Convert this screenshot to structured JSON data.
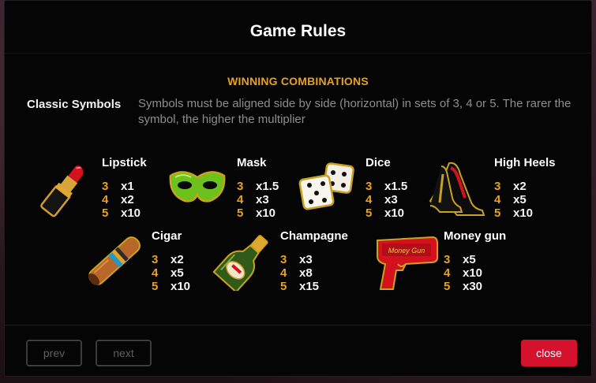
{
  "modal": {
    "title": "Game Rules",
    "section_title": "WINNING COMBINATIONS",
    "classic_label": "Classic Symbols",
    "classic_description": "Symbols must be aligned side by side (horizontal) in sets of 3, 4 or 5. The rarer the symbol, the higher the multiplier"
  },
  "symbols": [
    {
      "name": "Lipstick",
      "icon": "lipstick-icon",
      "payouts": [
        {
          "count": "3",
          "mult": "x1"
        },
        {
          "count": "4",
          "mult": "x2"
        },
        {
          "count": "5",
          "mult": "x10"
        }
      ]
    },
    {
      "name": "Mask",
      "icon": "mask-icon",
      "payouts": [
        {
          "count": "3",
          "mult": "x1.5"
        },
        {
          "count": "4",
          "mult": "x3"
        },
        {
          "count": "5",
          "mult": "x10"
        }
      ]
    },
    {
      "name": "Dice",
      "icon": "dice-icon",
      "payouts": [
        {
          "count": "3",
          "mult": "x1.5"
        },
        {
          "count": "4",
          "mult": "x3"
        },
        {
          "count": "5",
          "mult": "x10"
        }
      ]
    },
    {
      "name": "High Heels",
      "icon": "high-heels-icon",
      "payouts": [
        {
          "count": "3",
          "mult": "x2"
        },
        {
          "count": "4",
          "mult": "x5"
        },
        {
          "count": "5",
          "mult": "x10"
        }
      ]
    },
    {
      "name": "Cigar",
      "icon": "cigar-icon",
      "payouts": [
        {
          "count": "3",
          "mult": "x2"
        },
        {
          "count": "4",
          "mult": "x5"
        },
        {
          "count": "5",
          "mult": "x10"
        }
      ]
    },
    {
      "name": "Champagne",
      "icon": "champagne-icon",
      "payouts": [
        {
          "count": "3",
          "mult": "x3"
        },
        {
          "count": "4",
          "mult": "x8"
        },
        {
          "count": "5",
          "mult": "x15"
        }
      ]
    },
    {
      "name": "Money gun",
      "icon": "money-gun-icon",
      "icon_text": "Money Gun",
      "payouts": [
        {
          "count": "3",
          "mult": "x5"
        },
        {
          "count": "4",
          "mult": "x10"
        },
        {
          "count": "5",
          "mult": "x30"
        }
      ]
    }
  ],
  "footer": {
    "prev_label": "prev",
    "next_label": "next",
    "close_label": "close"
  },
  "colors": {
    "accent": "#e8a21d",
    "close_button": "#d5122e",
    "modal_background": "#050505",
    "description_text": "#8d8d8d"
  }
}
